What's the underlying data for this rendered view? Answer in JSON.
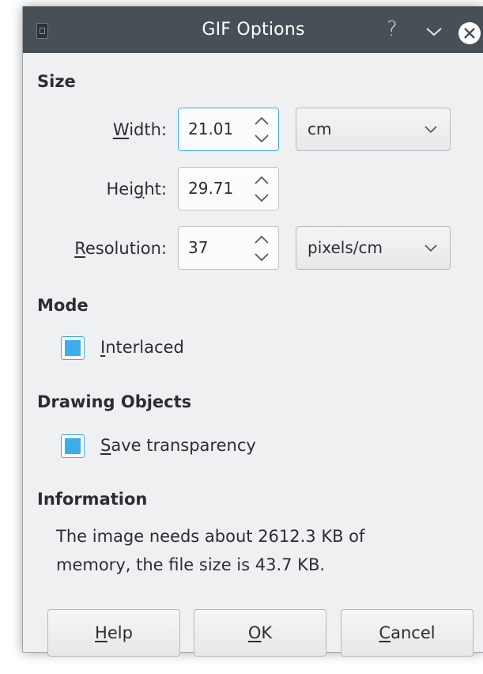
{
  "window": {
    "title": "GIF Options",
    "help_glyph": "?",
    "icons": [
      "app-icon",
      "help-icon",
      "minimize-icon",
      "close-icon"
    ]
  },
  "size": {
    "heading": "Size",
    "width_label": "Width:",
    "width_value": "21.01",
    "width_unit": "cm",
    "height_label": "Height:",
    "height_value": "29.71",
    "resolution_label": "Resolution:",
    "resolution_value": "37",
    "resolution_unit": "pixels/cm"
  },
  "mode": {
    "heading": "Mode",
    "interlaced_label": "Interlaced",
    "interlaced_checked": true
  },
  "drawing_objects": {
    "heading": "Drawing Objects",
    "save_transparency_label": "Save transparency",
    "save_transparency_checked": true
  },
  "information": {
    "heading": "Information",
    "line1": "The image needs about 2612.3 KB of",
    "line2": "memory, the file size is 43.7 KB."
  },
  "buttons": {
    "help": "Help",
    "ok": "OK",
    "cancel": "Cancel"
  },
  "colors": {
    "titlebar": "#475057",
    "accent": "#3daee9",
    "dialog_bg": "#eff0f1"
  }
}
